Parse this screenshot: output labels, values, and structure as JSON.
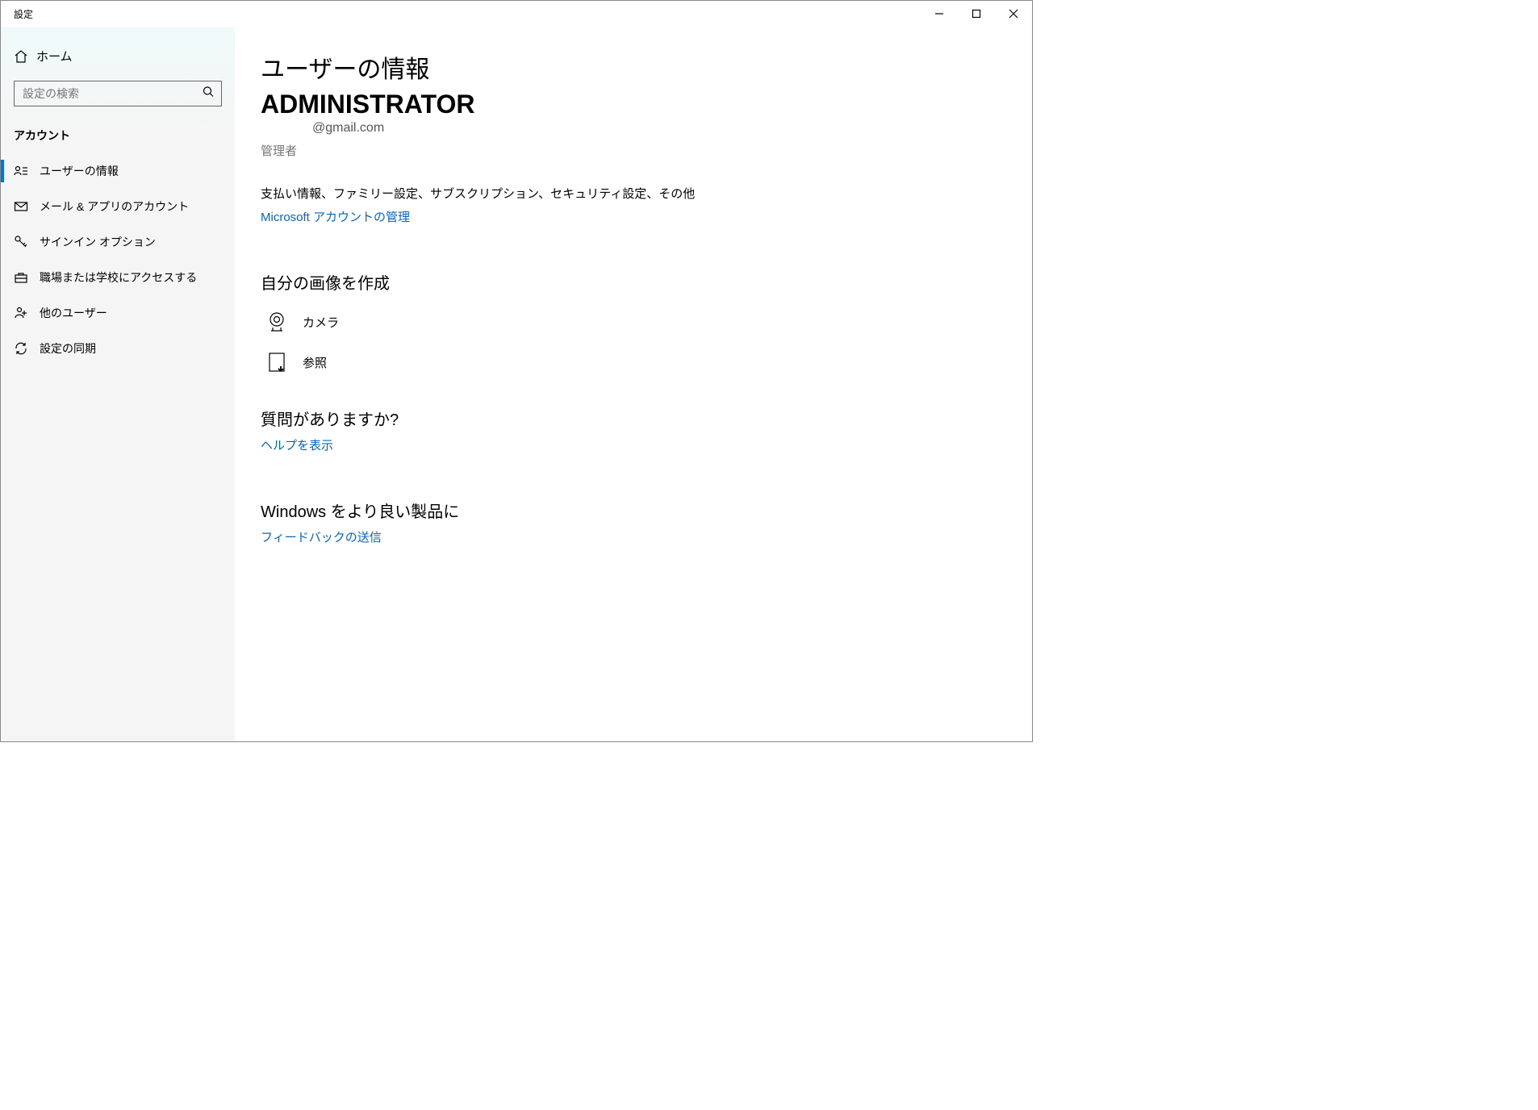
{
  "window": {
    "title": "設定"
  },
  "sidebar": {
    "home": "ホーム",
    "search_placeholder": "設定の検索",
    "section": "アカウント",
    "items": [
      {
        "label": "ユーザーの情報"
      },
      {
        "label": "メール & アプリのアカウント"
      },
      {
        "label": "サインイン オプション"
      },
      {
        "label": "職場または学校にアクセスする"
      },
      {
        "label": "他のユーザー"
      },
      {
        "label": "設定の同期"
      }
    ]
  },
  "main": {
    "page_title": "ユーザーの情報",
    "user_name": "ADMINISTRATOR",
    "user_email": "@gmail.com",
    "user_role": "管理者",
    "info_text": "支払い情報、ファミリー設定、サブスクリプション、セキュリティ設定、その他",
    "manage_link": "Microsoft アカウントの管理",
    "create_image_heading": "自分の画像を作成",
    "camera_label": "カメラ",
    "browse_label": "参照",
    "help_heading": "質問がありますか?",
    "help_link": "ヘルプを表示",
    "feedback_heading": "Windows をより良い製品に",
    "feedback_link": "フィードバックの送信"
  }
}
